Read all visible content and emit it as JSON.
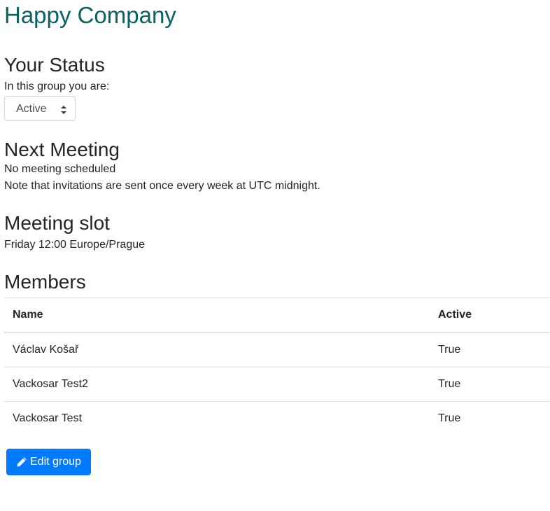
{
  "company": {
    "name": "Happy Company"
  },
  "status": {
    "heading": "Your Status",
    "label": "In this group you are:",
    "selected": "Active",
    "icon": "chevron-up-down-icon"
  },
  "next_meeting": {
    "heading": "Next Meeting",
    "message": "No meeting scheduled",
    "note": "Note that invitations are sent once every week at UTC midnight."
  },
  "meeting_slot": {
    "heading": "Meeting slot",
    "value": "Friday 12:00 Europe/Prague"
  },
  "members": {
    "heading": "Members",
    "columns": [
      "Name",
      "Active"
    ],
    "rows": [
      {
        "name": "Václav Košař",
        "active": "True"
      },
      {
        "name": "Vackosar Test2",
        "active": "True"
      },
      {
        "name": "Vackosar Test",
        "active": "True"
      }
    ]
  },
  "actions": {
    "edit_label": "Edit group",
    "edit_icon": "pencil-icon",
    "edit_color": "#007bff"
  },
  "colors": {
    "brand": "#0a6161",
    "text": "#212529",
    "border": "#dee2e6"
  }
}
